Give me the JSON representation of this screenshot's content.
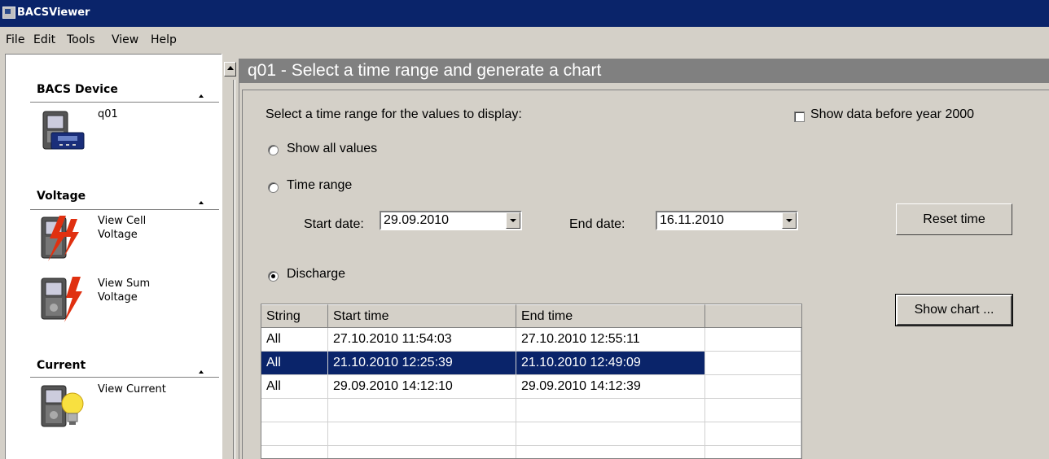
{
  "window": {
    "title": "BACSViewer"
  },
  "menu": [
    "File",
    "Edit",
    "Tools",
    "View",
    "Help"
  ],
  "sidebar": {
    "sections": [
      {
        "title": "BACS Device",
        "items": [
          "q01"
        ]
      },
      {
        "title": "Voltage",
        "items": [
          "View Cell\nVoltage",
          "View Sum\nVoltage"
        ]
      },
      {
        "title": "Current",
        "items": [
          "View Current"
        ]
      }
    ]
  },
  "main": {
    "header": "q01 - Select a time range and generate a chart",
    "prompt": "Select a time range for the values to display:",
    "show_before_2000": {
      "label": "Show data before year 2000",
      "checked": false
    },
    "radio_all": {
      "label": "Show all values",
      "checked": false
    },
    "radio_range": {
      "label": "Time range",
      "checked": false
    },
    "radio_discharge": {
      "label": "Discharge",
      "checked": true
    },
    "start_date_label": "Start date:",
    "start_date": "29.09.2010",
    "end_date_label": "End date:",
    "end_date": "16.11.2010",
    "reset_button": "Reset time",
    "show_chart_button": "Show chart ...",
    "table": {
      "columns": [
        "String",
        "Start time",
        "End time",
        ""
      ],
      "rows": [
        {
          "string": "All",
          "start": "27.10.2010 11:54:03",
          "end": "27.10.2010 12:55:11",
          "selected": false
        },
        {
          "string": "All",
          "start": "21.10.2010 12:25:39",
          "end": "21.10.2010 12:49:09",
          "selected": true
        },
        {
          "string": "All",
          "start": "29.09.2010 14:12:10",
          "end": "29.09.2010 14:12:39",
          "selected": false
        },
        {
          "string": "",
          "start": "",
          "end": "",
          "selected": false
        },
        {
          "string": "",
          "start": "",
          "end": "",
          "selected": false
        },
        {
          "string": "",
          "start": "",
          "end": "",
          "selected": false
        }
      ]
    }
  },
  "icons": {
    "device": "battery-monitor-icon",
    "cell_voltage": "cell-voltage-icon",
    "sum_voltage": "sum-voltage-icon",
    "current": "current-bulb-icon"
  },
  "colors": {
    "titlebar": "#0a246a",
    "selection": "#0a246a",
    "header": "#808080",
    "bolt": "#e03010",
    "bulb": "#f8e040"
  }
}
